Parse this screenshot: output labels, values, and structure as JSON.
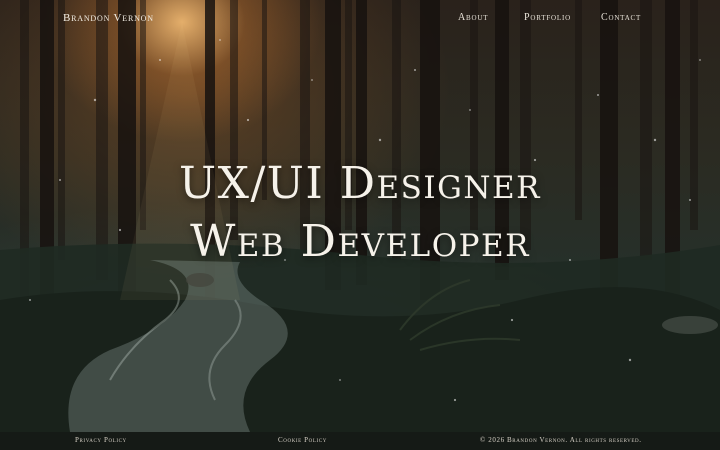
{
  "header": {
    "brand": "Brandon Vernon",
    "nav": [
      "About",
      "Portfolio",
      "Contact"
    ]
  },
  "hero": {
    "line1": "UX/UI Designer",
    "line2": "Web Developer"
  },
  "footer": {
    "privacy": "Privacy Policy",
    "cookie": "Cookie Policy",
    "copyright": "© 2026 Brandon Vernon. All rights reserved."
  },
  "colors": {
    "text": "#f2ede4",
    "footer_bg": "#151a16",
    "sun_glow": "#ffc478"
  }
}
